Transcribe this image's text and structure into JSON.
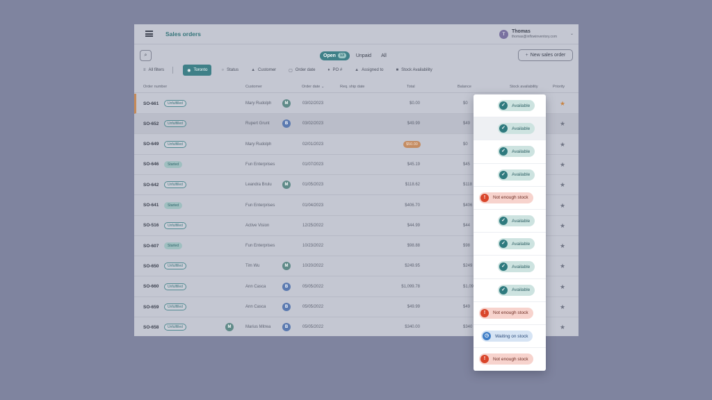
{
  "app": {
    "title": "Sales orders"
  },
  "user": {
    "initial": "T",
    "name": "Thomas",
    "email": "thomas@inflowinventory.com"
  },
  "tabs": [
    {
      "label": "Open",
      "count": "13",
      "active": true
    },
    {
      "label": "Unpaid",
      "active": false
    },
    {
      "label": "All",
      "active": false
    }
  ],
  "new_order_label": "New sales order",
  "filters": [
    {
      "label": "All filters",
      "icon": "≡",
      "icon_name": "filter-lines-icon"
    },
    {
      "label": "Toronto",
      "icon": "◉",
      "icon_name": "location-pin-icon",
      "active": true
    },
    {
      "label": "Status",
      "icon": "○",
      "icon_name": "status-circle-icon"
    },
    {
      "label": "Customer",
      "icon": "▲",
      "icon_name": "person-icon"
    },
    {
      "label": "Order date",
      "icon": "▢",
      "icon_name": "calendar-icon"
    },
    {
      "label": "PO #",
      "icon": "♦",
      "icon_name": "tag-icon"
    },
    {
      "label": "Assigned to",
      "icon": "▲",
      "icon_name": "person-icon"
    },
    {
      "label": "Stock Availability",
      "icon": "■",
      "icon_name": "box-icon"
    }
  ],
  "columns": {
    "order_number": "Order number",
    "customer": "Customer",
    "order_date": "Order date ⌄",
    "ship_date": "Req. ship date",
    "total": "Total",
    "balance": "Balance",
    "stock": "Stock availability",
    "priority": "Priority"
  },
  "rows": [
    {
      "num": "SO-661",
      "status": "Unfulfilled",
      "customer": "Mary Rudolph",
      "avatar": "M",
      "order_date": "03/02/2023",
      "total": "$0.00",
      "balance": "$0",
      "stock": "Available",
      "stock_kind": "ok",
      "priority": true
    },
    {
      "num": "SO-652",
      "status": "Unfulfilled",
      "customer": "Rupert Grunt",
      "avatar": "B",
      "order_date": "03/02/2023",
      "total": "$49.99",
      "balance": "$49",
      "stock": "Available",
      "stock_kind": "ok",
      "priority": false
    },
    {
      "num": "SO-649",
      "status": "Unfulfilled",
      "customer": "Mary Rudolph",
      "order_date": "02/01/2023",
      "total": "$50.00",
      "total_pill": true,
      "balance": "$0",
      "stock": "Available",
      "stock_kind": "ok",
      "priority": false
    },
    {
      "num": "SO-646",
      "status": "Started",
      "customer": "Fun Enterprises",
      "order_date": "01/07/2023",
      "total": "$45.19",
      "balance": "$45",
      "stock": "Available",
      "stock_kind": "ok",
      "priority": false
    },
    {
      "num": "SO-642",
      "status": "Unfulfilled",
      "customer": "Leandra Brulu",
      "avatar": "M",
      "order_date": "01/05/2023",
      "total": "$118.62",
      "balance": "$118",
      "stock": "Not enough stock",
      "stock_kind": "low",
      "priority": false
    },
    {
      "num": "SO-641",
      "status": "Started",
      "customer": "Fun Enterprises",
      "order_date": "01/04/2023",
      "total": "$406.70",
      "balance": "$406",
      "stock": "Available",
      "stock_kind": "ok",
      "priority": false
    },
    {
      "num": "SO-516",
      "status": "Unfulfilled",
      "customer": "Active Vision",
      "order_date": "12/25/2022",
      "total": "$44.99",
      "balance": "$44",
      "stock": "Available",
      "stock_kind": "ok",
      "priority": false
    },
    {
      "num": "SO-607",
      "status": "Started",
      "customer": "Fun Enterprises",
      "order_date": "10/23/2022",
      "total": "$98.88",
      "balance": "$98",
      "stock": "Available",
      "stock_kind": "ok",
      "priority": false
    },
    {
      "num": "SO-650",
      "status": "Unfulfilled",
      "customer": "Tim Wu",
      "avatar": "M",
      "order_date": "10/20/2022",
      "total": "$249.95",
      "balance": "$249",
      "stock": "Available",
      "stock_kind": "ok",
      "priority": false
    },
    {
      "num": "SO-660",
      "status": "Unfulfilled",
      "customer": "Ann Casca",
      "avatar": "B",
      "order_date": "05/05/2022",
      "total": "$1,099.78",
      "balance": "$1,099",
      "stock": "Not enough stock",
      "stock_kind": "low",
      "priority": false
    },
    {
      "num": "SO-659",
      "status": "Unfulfilled",
      "customer": "Ann Casca",
      "avatar": "B",
      "order_date": "05/05/2022",
      "total": "$49.99",
      "balance": "$49",
      "stock": "Waiting on stock",
      "stock_kind": "wait",
      "priority": false
    },
    {
      "num": "SO-658",
      "status": "Unfulfilled",
      "pre_avatar": "M",
      "customer": "Marius Mitrea",
      "avatar": "B",
      "order_date": "05/05/2022",
      "total": "$340.00",
      "balance": "$340",
      "stock": "Not enough stock",
      "stock_kind": "low",
      "priority": false
    }
  ],
  "icons": {
    "check": "✓",
    "alert": "!",
    "clock": "◷",
    "star": "★",
    "search": "⌕",
    "plus": "+",
    "caret": "⌄"
  },
  "colors": {
    "accent": "#3f8088",
    "priority_star": "#c98545",
    "available": "#2e7a7e",
    "not_enough": "#d9452a",
    "waiting": "#3f7ec7"
  }
}
